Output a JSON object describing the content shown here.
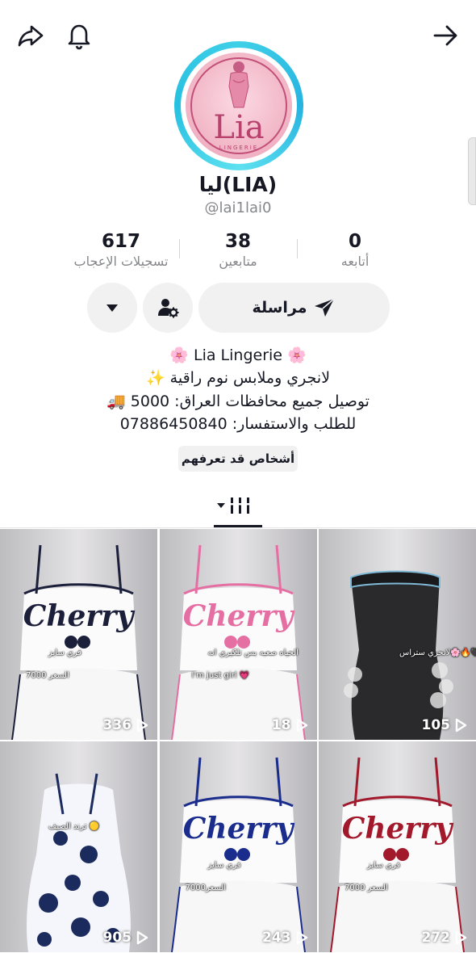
{
  "profile": {
    "display_name": "ليا(LIA)",
    "username": "@lai1lai0",
    "avatar_brand": "Lia",
    "avatar_sub": "LINGERIE"
  },
  "stats": {
    "likes": {
      "value": "617",
      "label": "تسجيلات الإعجاب"
    },
    "followers": {
      "value": "38",
      "label": "متابعين"
    },
    "following": {
      "value": "0",
      "label": "أتابعه"
    }
  },
  "actions": {
    "message_label": "مراسلة"
  },
  "bio": {
    "line1": "🌸 Lia Lingerie 🌸",
    "line2": "✨ لانجري وملابس نوم راقية",
    "line3": "🚚 توصيل جميع محافظات العراق: 5000",
    "line4": "للطلب والاستفسار: 07886450840"
  },
  "suggested_label": "أشخاص قد تعرفهم",
  "colors": {
    "accent_ring": "#3fd0e8",
    "text_primary": "#161823",
    "text_secondary": "#86878b",
    "button_bg": "#f1f1f2"
  },
  "videos": [
    {
      "views": "336",
      "caption_a": "فري سايز",
      "caption_b": "السعر 7000",
      "shirt": "Cherry",
      "trim": "#1b1f3a"
    },
    {
      "views": "18",
      "caption_a": "الحياه صعبه بس تلكيري انه",
      "caption_b": "I'm just girl 💗",
      "shirt": "Cherry",
      "trim": "#e56fa3"
    },
    {
      "views": "105",
      "caption_a": "لانجري ستراس🌸🔥🖤",
      "caption_b": "",
      "shirt": "",
      "trim": "#111111"
    },
    {
      "views": "905",
      "caption_a": "ترند الصيف 🟡",
      "caption_b": "",
      "shirt": "",
      "trim": "#1c2b5e"
    },
    {
      "views": "243",
      "caption_a": "فري سايز",
      "caption_b": "السعر7000",
      "shirt": "Cherry",
      "trim": "#1a2d8c"
    },
    {
      "views": "272",
      "caption_a": "فري سايز",
      "caption_b": "السعر 7000",
      "shirt": "Cherry",
      "trim": "#a3192c"
    }
  ]
}
